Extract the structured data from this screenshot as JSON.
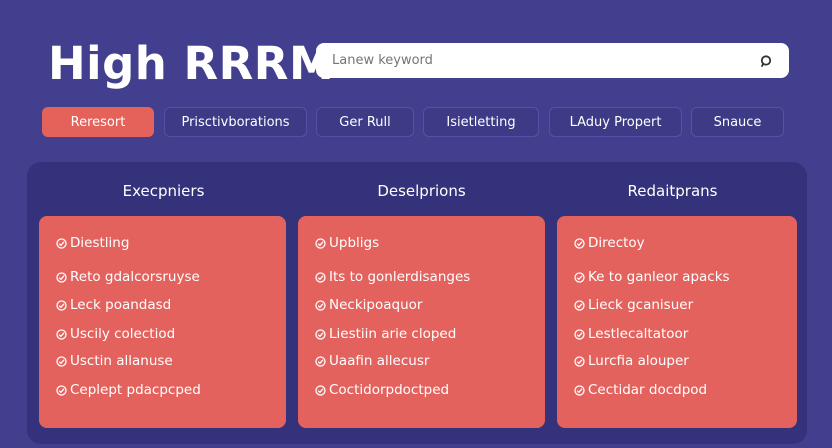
{
  "header": {
    "title": "High RRRM"
  },
  "search": {
    "placeholder": "Lanew keyword",
    "icon": "search-icon"
  },
  "tabs": [
    {
      "label": "Reresort",
      "active": true
    },
    {
      "label": "Prisctivborations",
      "active": false
    },
    {
      "label": "Ger Rull",
      "active": false
    },
    {
      "label": "Isietletting",
      "active": false
    },
    {
      "label": "LAduy Propert",
      "active": false
    },
    {
      "label": "Snauce",
      "active": false
    }
  ],
  "columns": [
    {
      "title": "Execpniers",
      "items": [
        "Diestling",
        "Reto gdalcorsruyse",
        "Leck poandasd",
        "Uscily colectiod",
        "Usctin allanuse",
        "Ceplept pdacpcped"
      ]
    },
    {
      "title": "Deselprions",
      "items": [
        "Upbligs",
        "Its to gonlerdisanges",
        "Neckipoaquor",
        "Liestiin arie cloped",
        "Uaafin allecusr",
        "Coctidorpdoctped"
      ]
    },
    {
      "title": "Redaitprans",
      "items": [
        "Directoy",
        "Ke to ganleor apacks",
        "Lieck gcanisuer",
        "Lestlecaltatoor",
        "Lurcfia alouper",
        "Cectidar docdpod"
      ]
    }
  ],
  "colors": {
    "background": "#423f8f",
    "panel": "#34327a",
    "accent": "#e4625d",
    "tab": "#3d3a86"
  }
}
